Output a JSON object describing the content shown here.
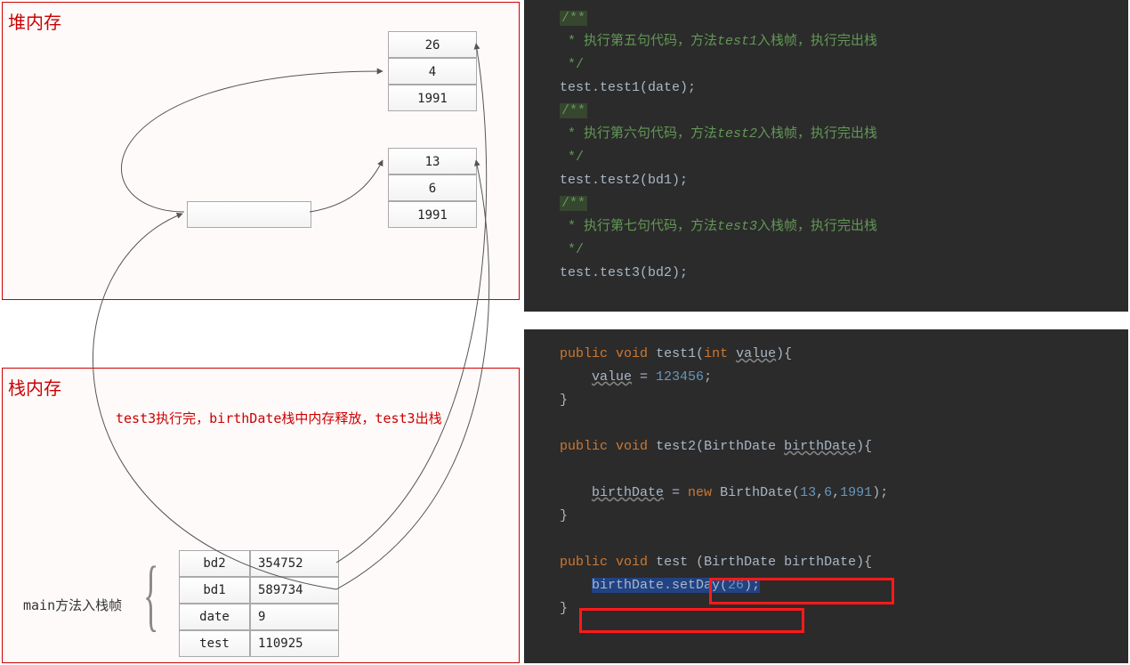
{
  "diagram": {
    "heap": {
      "title": "堆内存",
      "obj1": {
        "day": "26",
        "month": "4",
        "year": "1991"
      },
      "obj2": {
        "day": "13",
        "month": "6",
        "year": "1991"
      },
      "obj3_empty": ""
    },
    "stack": {
      "title": "栈内存",
      "note1": "test3执行完，birthDate栈中内存释放，test3出栈",
      "frame_label": "main方法入栈帧",
      "rows": [
        {
          "name": "bd2",
          "val": "354752"
        },
        {
          "name": "bd1",
          "val": "589734"
        },
        {
          "name": "date",
          "val": "9"
        },
        {
          "name": "test",
          "val": "110925"
        }
      ]
    }
  },
  "code1": {
    "c1a": "/**",
    "c1b": " * 执行第五句代码，方法",
    "c1b_i": "test1",
    "c1c": "入栈帧，执行完出栈",
    "c1d": " */",
    "l1": "test.test1(date);",
    "c2a": "/**",
    "c2b": " * 执行第六句代码，方法",
    "c2b_i": "test2",
    "c2c": "入栈帧，执行完出栈",
    "c2d": " */",
    "l2": "test.test2(bd1);",
    "c3a": "/**",
    "c3b": " * 执行第七句代码，方法",
    "c3b_i": "test3",
    "c3c": "入栈帧，执行完出栈",
    "c3d": " */",
    "l3": "test.test3(bd2);"
  },
  "code2": {
    "m1_sig_a": "public",
    "m1_sig_b": "void",
    "m1_sig_c": "test1",
    "m1_sig_d": "int",
    "m1_sig_e": "value",
    "m1_body_a": "value",
    "m1_body_b": "123456",
    "m2_sig_a": "public",
    "m2_sig_b": "void",
    "m2_sig_c": "test2",
    "m2_sig_d": "BirthDate",
    "m2_sig_e": "birthDate",
    "m2_body_a": "birthDate",
    "m2_body_b": "new",
    "m2_body_c": "BirthDate",
    "m2_body_d": "13",
    "m2_body_e": "6",
    "m2_body_f": "1991",
    "m3_sig_a": "public",
    "m3_sig_b": "void",
    "m3_sig_c": "test",
    "m3_sig_d": "BirthDate",
    "m3_sig_e": "birthDate",
    "m3_body_a": "birthDate.setDay(",
    "m3_body_b": "26",
    "m3_body_c": ");"
  }
}
